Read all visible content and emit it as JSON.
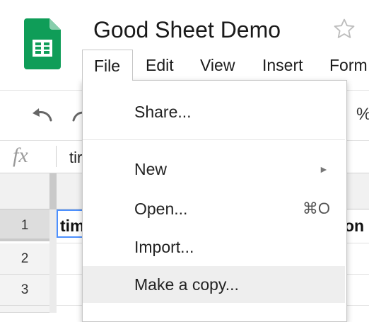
{
  "document": {
    "title": "Good Sheet Demo"
  },
  "menubar": {
    "items": [
      "File",
      "Edit",
      "View",
      "Insert",
      "Form"
    ]
  },
  "toolbar": {
    "percent_label": "%"
  },
  "formula_bar": {
    "fx_label": "fx",
    "value": "tir"
  },
  "grid": {
    "rows": [
      "1",
      "2",
      "3"
    ],
    "cell_a1": "tim",
    "cell_right_partial": "on"
  },
  "file_menu": {
    "items": [
      {
        "label": "Share...",
        "shortcut": "",
        "submenu": false
      },
      {
        "label": "New",
        "shortcut": "",
        "submenu": true
      },
      {
        "label": "Open...",
        "shortcut": "⌘O",
        "submenu": false
      },
      {
        "label": "Import...",
        "shortcut": "",
        "submenu": false
      },
      {
        "label": "Make a copy...",
        "shortcut": "",
        "submenu": false,
        "highlighted": true
      }
    ],
    "submenu_arrow": "►"
  },
  "colors": {
    "logo_green": "#0F9D58",
    "selection_blue": "#4D90FE",
    "menu_highlight": "#EEEEEE"
  },
  "icons": [
    "sheets-logo-icon",
    "star-icon",
    "undo-icon",
    "redo-icon",
    "fx-icon",
    "submenu-arrow-icon"
  ]
}
